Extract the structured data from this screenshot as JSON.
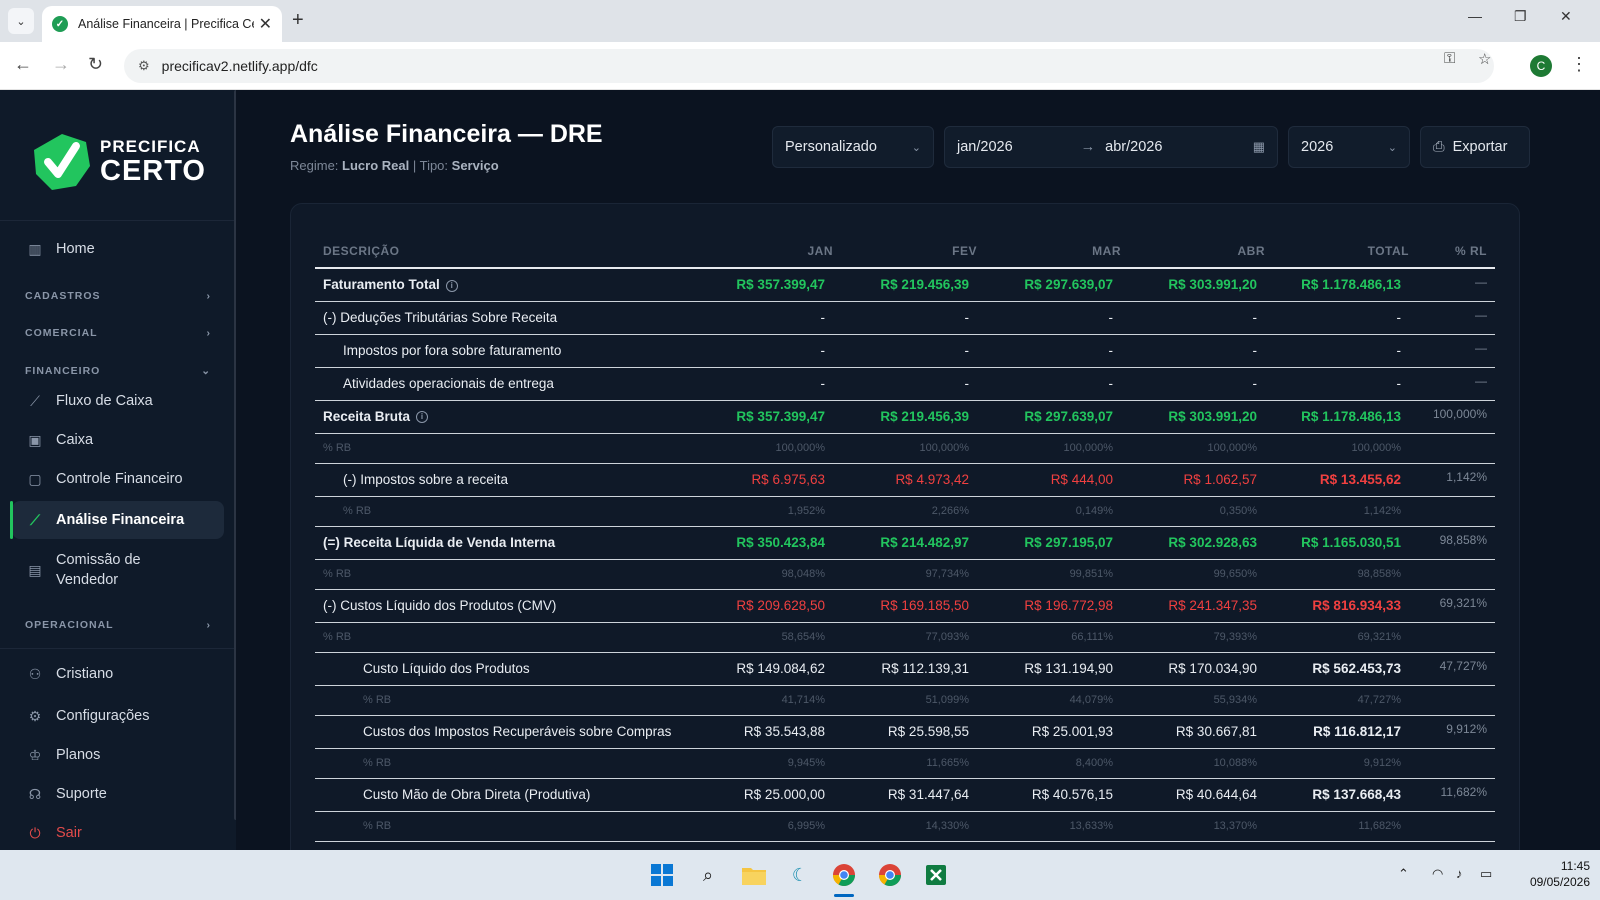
{
  "browser": {
    "tab_title": "Análise Financeira | Precifica Certo",
    "url": "precificav2.netlify.app/dfc",
    "profile_initial": "C"
  },
  "sidebar": {
    "logo_line1": "PRECIFICA",
    "logo_line2": "CERTO",
    "home": "Home",
    "sections": {
      "cadastros": "CADASTROS",
      "comercial": "COMERCIAL",
      "financeiro": "FINANCEIRO",
      "operacional": "OPERACIONAL"
    },
    "financeiro_items": [
      "Fluxo de Caixa",
      "Caixa",
      "Controle Financeiro",
      "Análise Financeira",
      "Comissão de Vendedor"
    ],
    "bottom_items": [
      "Cristiano",
      "Configurações",
      "Planos",
      "Suporte",
      "Sair"
    ],
    "active_item": "Análise Financeira"
  },
  "header": {
    "title": "Análise Financeira — DRE",
    "regime_label": "Regime:",
    "regime_value": "Lucro Real",
    "tipo_label": "Tipo:",
    "tipo_value": "Serviço",
    "period_select": "Personalizado",
    "date_from": "jan/2026",
    "date_to": "abr/2026",
    "year_select": "2026",
    "export_label": "Exportar"
  },
  "table": {
    "columns": [
      "DESCRIÇÃO",
      "JAN",
      "FEV",
      "MAR",
      "ABR",
      "TOTAL",
      "% RL"
    ],
    "rows": [
      {
        "kind": "main",
        "indent": 0,
        "bold": true,
        "info": true,
        "color": "green",
        "desc": "Faturamento Total",
        "values": [
          "R$ 357.399,47",
          "R$ 219.456,39",
          "R$ 297.639,07",
          "R$ 303.991,20",
          "R$ 1.178.486,13"
        ],
        "rl": "—"
      },
      {
        "kind": "main",
        "indent": 0,
        "bold": false,
        "info": false,
        "color": "",
        "desc": "(-) Deduções Tributárias Sobre Receita",
        "values": [
          "-",
          "-",
          "-",
          "-",
          "-"
        ],
        "rl": "—"
      },
      {
        "kind": "main",
        "indent": 1,
        "bold": false,
        "info": false,
        "color": "",
        "desc": "Impostos por fora sobre faturamento",
        "values": [
          "-",
          "-",
          "-",
          "-",
          "-"
        ],
        "rl": "—"
      },
      {
        "kind": "main",
        "indent": 1,
        "bold": false,
        "info": false,
        "color": "",
        "desc": "Atividades operacionais de entrega",
        "values": [
          "-",
          "-",
          "-",
          "-",
          "-"
        ],
        "rl": "—"
      },
      {
        "kind": "main",
        "indent": 0,
        "bold": true,
        "info": true,
        "color": "green",
        "desc": "Receita Bruta",
        "values": [
          "R$ 357.399,47",
          "R$ 219.456,39",
          "R$ 297.639,07",
          "R$ 303.991,20",
          "R$ 1.178.486,13"
        ],
        "rl": "100,000%"
      },
      {
        "kind": "pct",
        "indent": 0,
        "desc": "% RB",
        "values": [
          "100,000%",
          "100,000%",
          "100,000%",
          "100,000%",
          "100,000%"
        ]
      },
      {
        "kind": "main",
        "indent": 1,
        "bold": false,
        "info": false,
        "color": "red",
        "desc": "(-) Impostos sobre a receita",
        "values": [
          "R$ 6.975,63",
          "R$ 4.973,42",
          "R$ 444,00",
          "R$ 1.062,57",
          "R$ 13.455,62"
        ],
        "rl": "1,142%"
      },
      {
        "kind": "pct",
        "indent": 1,
        "desc": "% RB",
        "values": [
          "1,952%",
          "2,266%",
          "0,149%",
          "0,350%",
          "1,142%"
        ]
      },
      {
        "kind": "main",
        "indent": 0,
        "bold": true,
        "info": false,
        "color": "green",
        "desc": "(=) Receita Líquida de Venda Interna",
        "values": [
          "R$ 350.423,84",
          "R$ 214.482,97",
          "R$ 297.195,07",
          "R$ 302.928,63",
          "R$ 1.165.030,51"
        ],
        "rl": "98,858%"
      },
      {
        "kind": "pct",
        "indent": 0,
        "desc": "% RB",
        "values": [
          "98,048%",
          "97,734%",
          "99,851%",
          "99,650%",
          "98,858%"
        ]
      },
      {
        "kind": "main",
        "indent": 0,
        "bold": false,
        "info": false,
        "color": "red",
        "desc": "(-) Custos Líquido dos Produtos (CMV)",
        "values": [
          "R$ 209.628,50",
          "R$ 169.185,50",
          "R$ 196.772,98",
          "R$ 241.347,35",
          "R$ 816.934,33"
        ],
        "rl": "69,321%"
      },
      {
        "kind": "pct",
        "indent": 0,
        "desc": "% RB",
        "values": [
          "58,654%",
          "77,093%",
          "66,111%",
          "79,393%",
          "69,321%"
        ]
      },
      {
        "kind": "main",
        "indent": 2,
        "bold": false,
        "info": false,
        "color": "",
        "desc": "Custo Líquido dos Produtos",
        "values": [
          "R$ 149.084,62",
          "R$ 112.139,31",
          "R$ 131.194,90",
          "R$ 170.034,90",
          "R$ 562.453,73"
        ],
        "rl": "47,727%"
      },
      {
        "kind": "pct",
        "indent": 2,
        "desc": "% RB",
        "values": [
          "41,714%",
          "51,099%",
          "44,079%",
          "55,934%",
          "47,727%"
        ]
      },
      {
        "kind": "main",
        "indent": 2,
        "bold": false,
        "info": false,
        "color": "",
        "desc": "Custos dos Impostos Recuperáveis sobre Compras",
        "values": [
          "R$ 35.543,88",
          "R$ 25.598,55",
          "R$ 25.001,93",
          "R$ 30.667,81",
          "R$ 116.812,17"
        ],
        "rl": "9,912%"
      },
      {
        "kind": "pct",
        "indent": 2,
        "desc": "% RB",
        "values": [
          "9,945%",
          "11,665%",
          "8,400%",
          "10,088%",
          "9,912%"
        ]
      },
      {
        "kind": "main",
        "indent": 2,
        "bold": false,
        "info": false,
        "color": "",
        "desc": "Custo Mão de Obra Direta (Produtiva)",
        "values": [
          "R$ 25.000,00",
          "R$ 31.447,64",
          "R$ 40.576,15",
          "R$ 40.644,64",
          "R$ 137.668,43"
        ],
        "rl": "11,682%"
      },
      {
        "kind": "pct",
        "indent": 2,
        "desc": "% RB",
        "values": [
          "6,995%",
          "14,330%",
          "13,633%",
          "13,370%",
          "11,682%"
        ]
      }
    ]
  },
  "taskbar": {
    "time": "11:45",
    "date": "09/05/2026"
  },
  "colors": {
    "accent_green": "#22c55e",
    "negative_red": "#f04040",
    "background": "#0b1320"
  }
}
